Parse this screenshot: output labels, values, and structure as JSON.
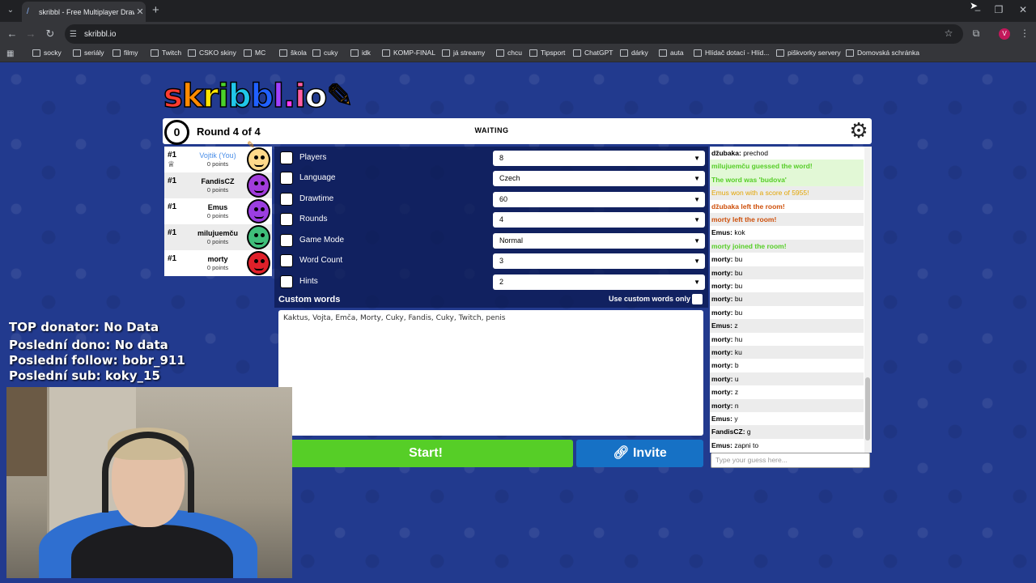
{
  "browser": {
    "tab_title": "skribbl - Free Multiplayer Drawin",
    "url": "skribbl.io",
    "profile_initial": "V",
    "bookmarks": [
      {
        "label": "socky"
      },
      {
        "label": "seriály"
      },
      {
        "label": "filmy"
      },
      {
        "label": "Twitch"
      },
      {
        "label": "CSKO skiny"
      },
      {
        "label": "MC"
      },
      {
        "label": "škola"
      },
      {
        "label": "cuky"
      },
      {
        "label": "idk"
      },
      {
        "label": "KOMP-FINAL"
      },
      {
        "label": "já streamy"
      },
      {
        "label": "chcu"
      },
      {
        "label": "Tipsport"
      },
      {
        "label": "ChatGPT"
      },
      {
        "label": "dárky"
      },
      {
        "label": "auta"
      },
      {
        "label": "Hlídač dotací - Hlíd..."
      },
      {
        "label": "piškvorky servery"
      },
      {
        "label": "Domovská schránka"
      }
    ]
  },
  "game": {
    "logo_letters": [
      "s",
      "k",
      "r",
      "i",
      "b",
      "b",
      "l",
      ".",
      "i",
      "o"
    ],
    "logo_colors": [
      "#ff3b2f",
      "#ff8a00",
      "#ffe400",
      "#4bd12b",
      "#20c6e8",
      "#2060ff",
      "#a040ff",
      "#ff3bff",
      "#ff5ea3",
      "#ffffff"
    ],
    "timer": "0",
    "round": "Round 4 of 4",
    "status": "WAITING"
  },
  "players": [
    {
      "rank": "#1",
      "name": "Vojtik (You)",
      "points": "0 points",
      "color": "#ffd98a",
      "is_you": true
    },
    {
      "rank": "#1",
      "name": "FandisCZ",
      "points": "0 points",
      "color": "#a13cdb",
      "is_you": false
    },
    {
      "rank": "#1",
      "name": "Emus",
      "points": "0 points",
      "color": "#9b3ee0",
      "is_you": false
    },
    {
      "rank": "#1",
      "name": "milujuemču",
      "points": "0 points",
      "color": "#3fbf7a",
      "is_you": false
    },
    {
      "rank": "#1",
      "name": "morty",
      "points": "0 points",
      "color": "#e0202a",
      "is_you": false
    }
  ],
  "settings": [
    {
      "label": "Players",
      "value": "8"
    },
    {
      "label": "Language",
      "value": "Czech"
    },
    {
      "label": "Drawtime",
      "value": "60"
    },
    {
      "label": "Rounds",
      "value": "4"
    },
    {
      "label": "Game Mode",
      "value": "Normal"
    },
    {
      "label": "Word Count",
      "value": "3"
    },
    {
      "label": "Hints",
      "value": "2"
    }
  ],
  "custom_words": {
    "title": "Custom words",
    "only_label": "Use custom words only",
    "text": "Kaktus, Vojta, Emča, Morty, Cuky, Fandis, Cuky, Twitch, penis"
  },
  "buttons": {
    "start": "Start!",
    "invite": "Invite"
  },
  "chat": {
    "messages": [
      {
        "author": "džubaka:",
        "text": " prechod",
        "type": "normal"
      },
      {
        "author": "",
        "text": "milujuemču guessed the word!",
        "type": "guess"
      },
      {
        "author": "",
        "text": "The word was 'budova'",
        "type": "guess"
      },
      {
        "author": "",
        "text": "Emus won with a score of 5955!",
        "type": "info"
      },
      {
        "author": "",
        "text": "džubaka left the room!",
        "type": "leave"
      },
      {
        "author": "",
        "text": "morty left the room!",
        "type": "leave"
      },
      {
        "author": "Emus:",
        "text": " kok",
        "type": "normal"
      },
      {
        "author": "",
        "text": "morty joined the room!",
        "type": "join"
      },
      {
        "author": "morty:",
        "text": " bu",
        "type": "normal"
      },
      {
        "author": "morty:",
        "text": " bu",
        "type": "normal"
      },
      {
        "author": "morty:",
        "text": " bu",
        "type": "normal"
      },
      {
        "author": "morty:",
        "text": " bu",
        "type": "normal"
      },
      {
        "author": "morty:",
        "text": " bu",
        "type": "normal"
      },
      {
        "author": "Emus:",
        "text": " z",
        "type": "normal"
      },
      {
        "author": "morty:",
        "text": " hu",
        "type": "normal"
      },
      {
        "author": "morty:",
        "text": " ku",
        "type": "normal"
      },
      {
        "author": "morty:",
        "text": " b",
        "type": "normal"
      },
      {
        "author": "morty:",
        "text": " u",
        "type": "normal"
      },
      {
        "author": "morty:",
        "text": " z",
        "type": "normal"
      },
      {
        "author": "morty:",
        "text": " n",
        "type": "normal"
      },
      {
        "author": "Emus:",
        "text": " y",
        "type": "normal"
      },
      {
        "author": "FandisCZ:",
        "text": " g",
        "type": "normal"
      },
      {
        "author": "Emus:",
        "text": " zapni to",
        "type": "normal"
      }
    ],
    "input_placeholder": "Type your guess here..."
  },
  "overlay": {
    "top_donator": "TOP donator: No Data",
    "last_dono": "Poslední dono: No data",
    "last_follow": "Poslední follow: bobr_911",
    "last_sub": "Poslední sub: koky_15"
  }
}
